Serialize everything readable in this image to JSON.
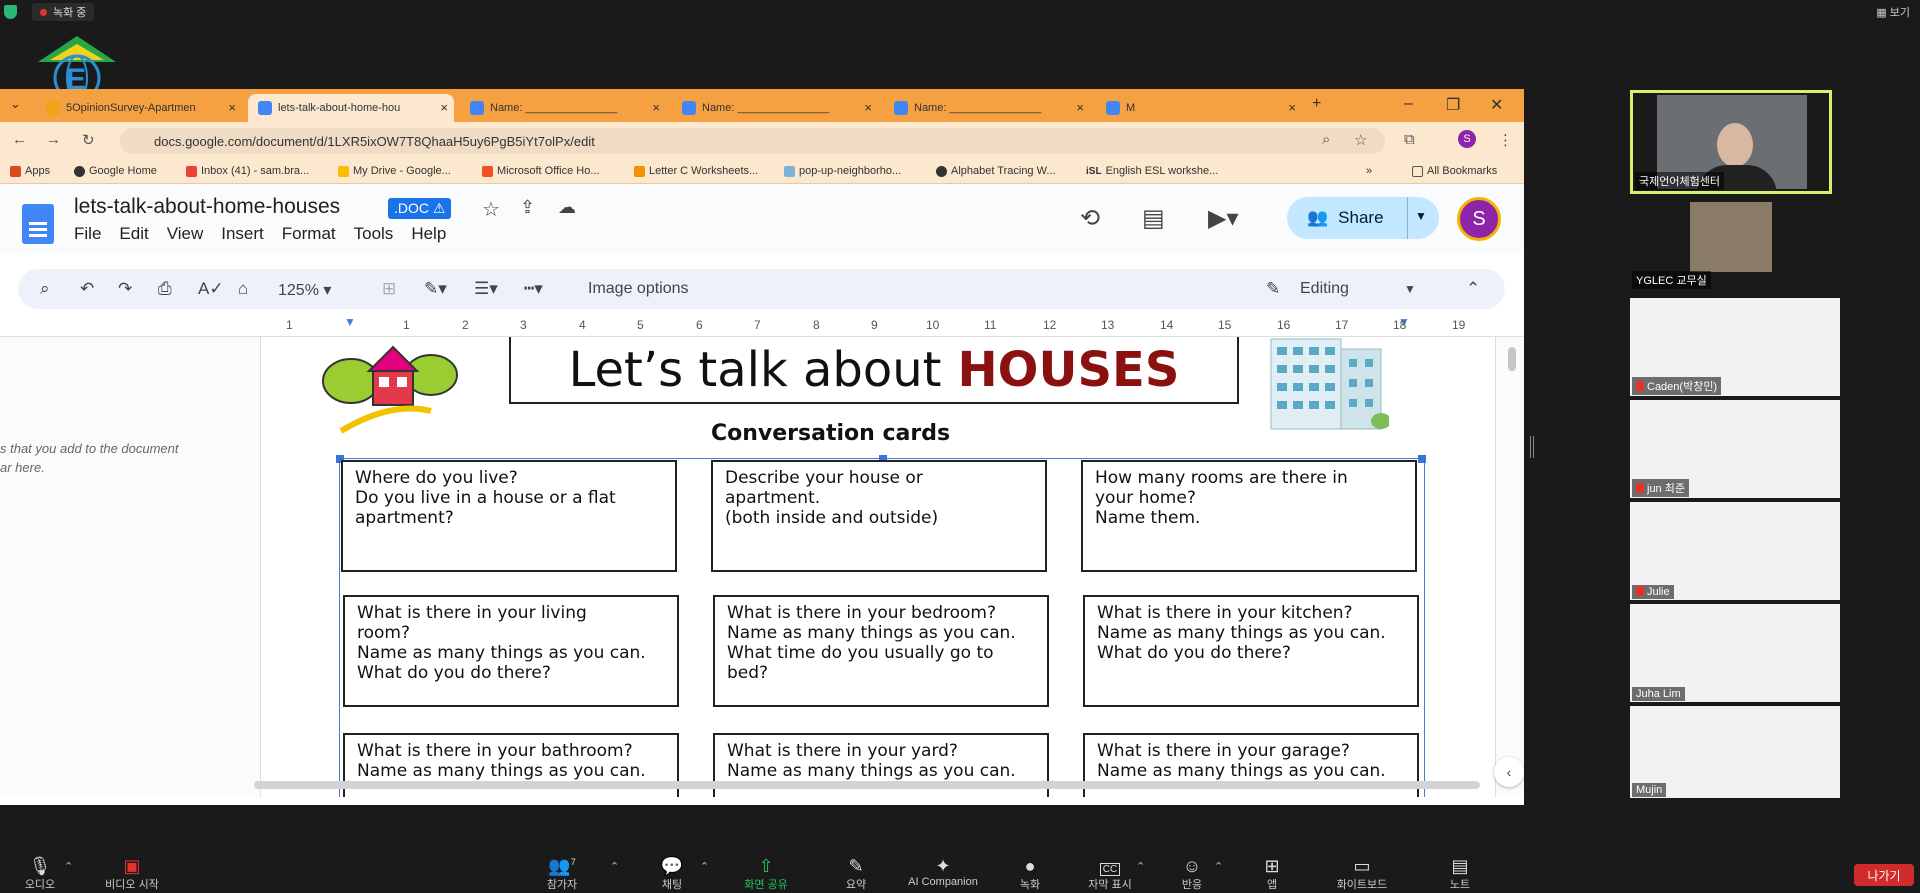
{
  "zoom": {
    "recording": "녹화 중",
    "view": "보기",
    "leave": "나가기",
    "bottom": [
      {
        "label": "오디오",
        "icon": "mic-icon"
      },
      {
        "label": "비디오 시작",
        "icon": "video-off-icon"
      },
      {
        "label": "참가자",
        "icon": "participants-icon",
        "count": "7"
      },
      {
        "label": "채팅",
        "icon": "chat-icon"
      },
      {
        "label": "화면 공유",
        "icon": "share-screen-icon"
      },
      {
        "label": "요약",
        "icon": "summary-icon"
      },
      {
        "label": "AI Companion",
        "icon": "ai-companion-icon"
      },
      {
        "label": "녹화",
        "icon": "record-icon"
      },
      {
        "label": "자막 표시",
        "icon": "cc-icon",
        "badge": "CC"
      },
      {
        "label": "반응",
        "icon": "reaction-icon"
      },
      {
        "label": "앱",
        "icon": "apps-icon"
      },
      {
        "label": "화이트보드",
        "icon": "whiteboard-icon"
      },
      {
        "label": "노트",
        "icon": "notes-icon"
      }
    ],
    "participants": [
      "국제언어체험센터",
      "YGLEC 교무실",
      "Caden(박창민)",
      "jun 최준",
      "Julie",
      "Juha Lim",
      "Mujin"
    ]
  },
  "browser": {
    "tabs": [
      {
        "title": "5OpinionSurvey-Apartmen",
        "color": "#f4a11a"
      },
      {
        "title": "lets-talk-about-home-hou",
        "color": "#4285f4"
      },
      {
        "title": "Name: _______________",
        "color": "#4285f4"
      },
      {
        "title": "Name: _______________",
        "color": "#4285f4"
      },
      {
        "title": "Name: _______________",
        "color": "#4285f4"
      },
      {
        "title": "M",
        "color": "#4285f4"
      }
    ],
    "url": "docs.google.com/document/d/1LXR5ixOW7T8QhaaH5uy6PgB5iYt7olPx/edit",
    "profile": "S",
    "bookmarks": [
      "Apps",
      "Google Home",
      "Inbox (41) - sam.bra...",
      "My Drive - Google...",
      "Microsoft Office Ho...",
      "Letter C Worksheets...",
      "pop-up-neighborho...",
      "Alphabet Tracing W...",
      "English ESL workshe..."
    ],
    "all_bookmarks": "All Bookmarks"
  },
  "doc": {
    "title": "lets-talk-about-home-houses",
    "badge": ".DOC ⚠",
    "menus": [
      "File",
      "Edit",
      "View",
      "Insert",
      "Format",
      "Tools",
      "Help"
    ],
    "share": "Share",
    "avatar": "S",
    "zoom": "125%",
    "image_options": "Image options",
    "mode": "Editing",
    "ruler": [
      "1",
      "1",
      "2",
      "3",
      "4",
      "5",
      "6",
      "7",
      "8",
      "9",
      "10",
      "11",
      "12",
      "13",
      "14",
      "15",
      "16",
      "17",
      "18",
      "19"
    ],
    "side_note_1": "s that you add to the document",
    "side_note_2": "ar here.",
    "banner_a": "Let’s talk about",
    "banner_b": "HOUSES",
    "subtitle": "Conversation cards",
    "cards": [
      [
        "Where do you live?",
        "Do you live in a house or a flat",
        "apartment?"
      ],
      [
        "Describe your house or",
        "apartment.",
        "(both inside and outside)"
      ],
      [
        "How many rooms are there in",
        "your home?",
        "Name them."
      ],
      [
        "What is there in your living",
        "room?",
        "Name as many things as you can.",
        "What do you do there?"
      ],
      [
        "What is there in your bedroom?",
        "Name as many things as you can.",
        "What time do you usually go to",
        "bed?"
      ],
      [
        "What is there in your kitchen?",
        "Name as many things as you can.",
        "What do you do there?"
      ],
      [
        "What is there in your bathroom?",
        "Name as many things as you can."
      ],
      [
        "What is there in your yard?",
        "Name as many things as you can."
      ],
      [
        "What is there in your garage?",
        "Name as many things as you can."
      ]
    ]
  }
}
